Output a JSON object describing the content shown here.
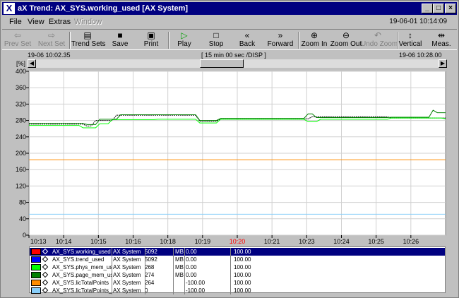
{
  "window": {
    "title": "aX Trend: AX_SYS.working_used [AX System]",
    "app_icon": "ax-logo-icon",
    "controls": [
      "_",
      "□",
      "×"
    ]
  },
  "menu": {
    "items": [
      {
        "label": "File",
        "enabled": true
      },
      {
        "label": "View",
        "enabled": true
      },
      {
        "label": "Extras",
        "enabled": true
      },
      {
        "label": "Window",
        "enabled": false
      }
    ],
    "clock": "19-06-01 10:14:09"
  },
  "toolbar": [
    {
      "label": "Prev Set",
      "icon": "arrow-left-icon",
      "glyph": "⇦",
      "enabled": false
    },
    {
      "label": "Next Set",
      "icon": "arrow-right-icon",
      "glyph": "⇨",
      "enabled": false
    },
    {
      "label": "Trend Sets",
      "icon": "trend-sets-icon",
      "glyph": "▤",
      "enabled": true
    },
    {
      "label": "Save",
      "icon": "floppy-disk-icon",
      "glyph": "■",
      "enabled": true
    },
    {
      "label": "Print",
      "icon": "printer-icon",
      "glyph": "▣",
      "enabled": true
    },
    {
      "label": "Play",
      "icon": "play-icon",
      "glyph": "▷",
      "enabled": true
    },
    {
      "label": "Stop",
      "icon": "stop-icon",
      "glyph": "□",
      "enabled": true
    },
    {
      "label": "Back",
      "icon": "rewind-icon",
      "glyph": "«",
      "enabled": true
    },
    {
      "label": "Forward",
      "icon": "fast-forward-icon",
      "glyph": "»",
      "enabled": true
    },
    {
      "label": "Zoom In",
      "icon": "zoom-in-icon",
      "glyph": "⊕",
      "enabled": true
    },
    {
      "label": "Zoom Out",
      "icon": "zoom-out-icon",
      "glyph": "⊖",
      "enabled": true
    },
    {
      "label": "Undo Zoom",
      "icon": "undo-icon",
      "glyph": "↶",
      "enabled": false
    },
    {
      "label": "Vertical",
      "icon": "vertical-cursor-icon",
      "glyph": "↕",
      "enabled": true
    },
    {
      "label": "Meas.",
      "icon": "measure-icon",
      "glyph": "⇹",
      "enabled": true
    }
  ],
  "timeline": {
    "start": "19-06 10:02.35",
    "span": "[ 15 min 00 sec /DISP ]",
    "end": "19-06 10:28.00"
  },
  "chart_data": {
    "type": "line",
    "y_unit_label": "[%]",
    "ylim": [
      0,
      400
    ],
    "y_ticks": [
      0,
      40,
      80,
      120,
      160,
      200,
      240,
      280,
      320,
      360,
      400
    ],
    "x_tick_labels": [
      "10:13",
      "10:14",
      "10:15",
      "10:16",
      "10:18",
      "10:19",
      "10:20",
      "10:21",
      "10:23",
      "10:24",
      "10:25",
      "10:26"
    ],
    "x_highlight_tick": "10:20",
    "highlight_color": "#ff0000",
    "grid": true,
    "x_range": [
      0,
      100
    ],
    "series": [
      {
        "name": "AX_SYS.working_used",
        "color": "#000000",
        "dashed": true,
        "x": [
          0,
          13,
          14,
          15,
          16,
          20,
          21,
          40,
          41,
          45,
          46,
          67,
          68,
          86,
          87,
          100
        ],
        "y": [
          271,
          271,
          266,
          267,
          280,
          280,
          293,
          293,
          278,
          278,
          284,
          284,
          289,
          289,
          286,
          286
        ]
      },
      {
        "name": "AX_SYS.trend_used",
        "color": "#0000ff",
        "dashed": false,
        "x": [
          0,
          100
        ],
        "y": [
          null,
          null
        ]
      },
      {
        "name": "AX_SYS.phys_mem_used",
        "color": "#00ff00",
        "dashed": false,
        "x": [
          0,
          12,
          13,
          16,
          17,
          19,
          20,
          30,
          31,
          40,
          41,
          45,
          46,
          66,
          67,
          69,
          70,
          86,
          87,
          99,
          100
        ],
        "y": [
          268,
          268,
          262,
          262,
          272,
          272,
          282,
          282,
          283,
          283,
          274,
          274,
          283,
          283,
          277,
          277,
          283,
          283,
          286,
          286,
          284
        ]
      },
      {
        "name": "AX_SYS.page_mem_used",
        "color": "#008000",
        "dashed": false,
        "x": [
          0,
          13,
          14,
          16,
          17,
          21,
          22,
          40,
          41,
          45,
          46,
          66,
          67,
          68,
          69,
          86,
          87,
          96,
          97,
          98,
          100
        ],
        "y": [
          273,
          273,
          270,
          270,
          283,
          283,
          294,
          294,
          280,
          280,
          285,
          285,
          296,
          296,
          287,
          287,
          288,
          288,
          305,
          299,
          299
        ]
      },
      {
        "name": "AX_SYS.licTotalPoints",
        "color": "#ff8c00",
        "dashed": false,
        "x": [
          0,
          100
        ],
        "y": [
          184,
          184
        ]
      },
      {
        "name": "AX_SYS.licTotalPoints_free",
        "color": "#87cefa",
        "dashed": false,
        "x": [
          0,
          100
        ],
        "y": [
          51,
          51
        ]
      }
    ]
  },
  "legend": [
    {
      "swatch": "#ff0000",
      "name": "AX_SYS.working_used",
      "system": "AX System",
      "value": "5092",
      "unit": "MB",
      "min": "0.00",
      "max": "100.00",
      "selected": true
    },
    {
      "swatch": "#0000ff",
      "name": "AX_SYS.trend_used",
      "system": "AX System",
      "value": "5092",
      "unit": "MB",
      "min": "0.00",
      "max": "100.00",
      "selected": false
    },
    {
      "swatch": "#00ff00",
      "name": "AX_SYS.phys_mem_use",
      "system": "AX System",
      "value": "268",
      "unit": "MB",
      "min": "0.00",
      "max": "100.00",
      "selected": false
    },
    {
      "swatch": "#008000",
      "name": "AX_SYS.page_mem_use",
      "system": "AX System",
      "value": "274",
      "unit": "MB",
      "min": "0.00",
      "max": "100.00",
      "selected": false
    },
    {
      "swatch": "#ff8c00",
      "name": "AX_SYS.licTotalPoints",
      "system": "AX System",
      "value": "264",
      "unit": "",
      "min": "-100.00",
      "max": "100.00",
      "selected": false
    },
    {
      "swatch": "#87cefa",
      "name": "AX_SYS.licTotalPoints_fr",
      "system": "AX System",
      "value": "0",
      "unit": "",
      "min": "-100.00",
      "max": "100.00",
      "selected": false
    }
  ]
}
